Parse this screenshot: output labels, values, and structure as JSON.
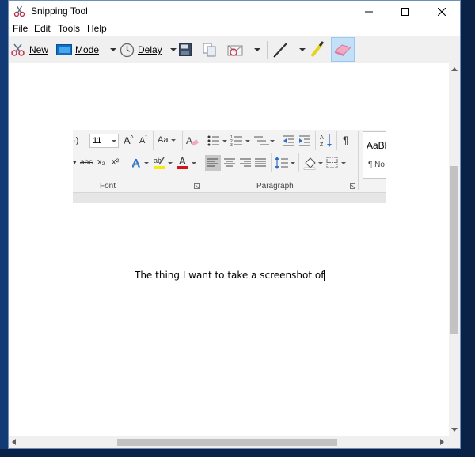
{
  "window": {
    "title": "Snipping Tool"
  },
  "menu": [
    "File",
    "Edit",
    "Tools",
    "Help"
  ],
  "toolbar": {
    "new_label": "New",
    "mode_label": "Mode",
    "delay_label": "Delay"
  },
  "ribbon": {
    "font_size": "11",
    "font_name_partial": "·)",
    "case_label": "Aa",
    "superscript": "x²",
    "subscript": "x₂",
    "strike_label": "abc",
    "font_group": "Font",
    "paragraph_group": "Paragraph",
    "style_preview": "AaBl",
    "style_name": "¶ No",
    "pilcrow": "¶"
  },
  "document": {
    "text": "The thing I want to take a screenshot of"
  },
  "colors": {
    "accent": "#0078d7",
    "selected_tool": "#c4e0f7",
    "desktop": "#0c2a55"
  }
}
